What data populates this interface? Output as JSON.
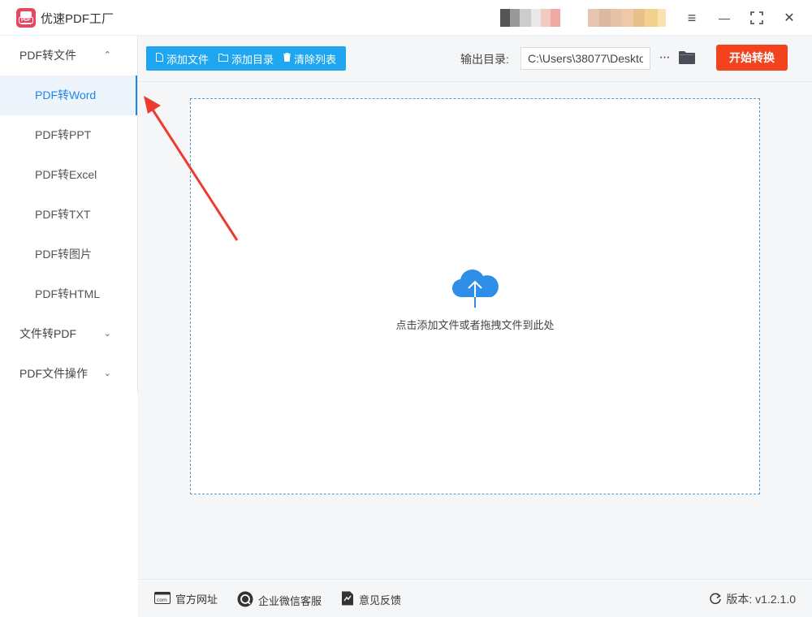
{
  "app": {
    "title": "优速PDF工厂",
    "logo_text": "PDF"
  },
  "window_controls": {
    "menu": "≡",
    "minimize": "—",
    "maximize": "⛶",
    "close": "✕"
  },
  "sidebar": {
    "groups": [
      {
        "label": "PDF转文件",
        "expanded": true,
        "chevron": "^"
      },
      {
        "label": "文件转PDF",
        "expanded": false,
        "chevron": "v"
      },
      {
        "label": "PDF文件操作",
        "expanded": false,
        "chevron": "v"
      }
    ],
    "items": [
      {
        "label": "PDF转Word",
        "active": true
      },
      {
        "label": "PDF转PPT"
      },
      {
        "label": "PDF转Excel"
      },
      {
        "label": "PDF转TXT"
      },
      {
        "label": "PDF转图片"
      },
      {
        "label": "PDF转HTML"
      }
    ]
  },
  "toolbar": {
    "add_file": "添加文件",
    "add_folder": "添加目录",
    "clear_list": "清除列表",
    "output_label": "输出目录:",
    "output_path": "C:\\Users\\38077\\Deskto",
    "more": "···",
    "start": "开始转换"
  },
  "dropzone": {
    "text": "点击添加文件或者拖拽文件到此处"
  },
  "statusbar": {
    "website": "官方网址",
    "wechat": "企业微信客服",
    "feedback": "意见反馈",
    "version": "版本: v1.2.1.0"
  },
  "colors": {
    "accent": "#1e87e5",
    "toolbar_btn": "#1ea7f0",
    "start_btn": "#f2431c",
    "logo": "#e8455f",
    "annotation_arrow": "#ee3b2f"
  },
  "icons": {
    "file": "file-icon",
    "folder": "folder-icon",
    "trash": "trash-icon",
    "cloud_upload": "cloud-upload-icon",
    "website": "web-icon",
    "wechat": "chat-icon",
    "feedback": "feedback-icon",
    "refresh": "refresh-icon"
  }
}
